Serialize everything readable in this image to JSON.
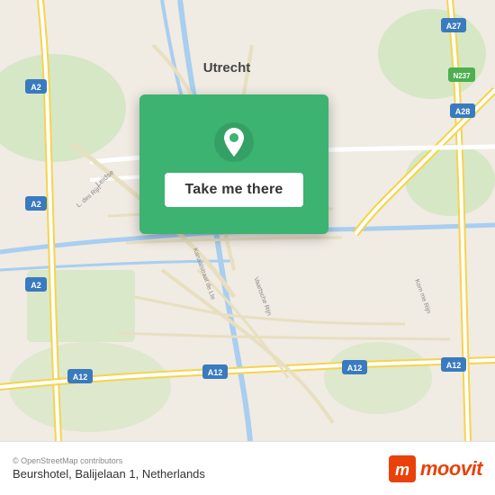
{
  "map": {
    "city": "Utrecht",
    "country": "Netherlands",
    "colors": {
      "background": "#f2efe9",
      "road_major": "#ffffff",
      "road_minor": "#f0e8d0",
      "green_area": "#c8e6c0",
      "water": "#b3d1f5",
      "highway": "#f6d44b"
    }
  },
  "card": {
    "background_color": "#3cb371",
    "button_label": "Take me there"
  },
  "footer": {
    "osm_credit": "© OpenStreetMap contributors",
    "location_text": "Beurshotel, Balijelaan 1, Netherlands",
    "logo_text": "moovit"
  }
}
